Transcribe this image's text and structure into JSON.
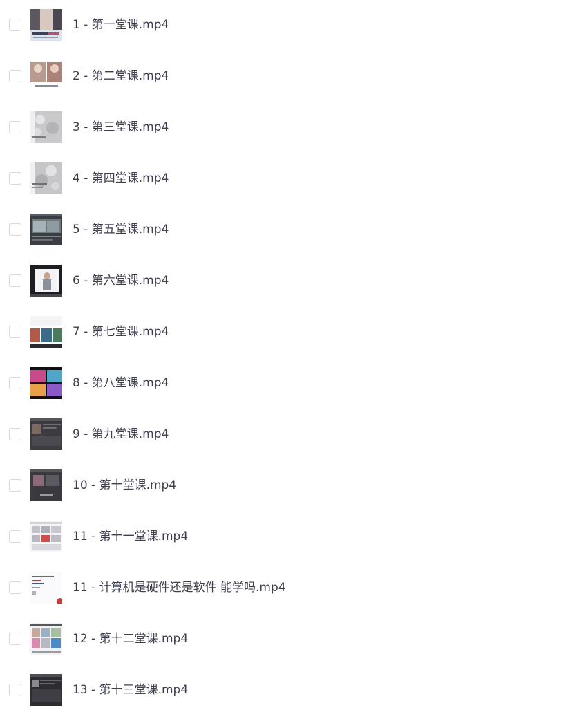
{
  "files": [
    {
      "name": "1 - 第一堂课.mp4",
      "thumb": "thumb-portrait-collage"
    },
    {
      "name": "2 - 第二堂课.mp4",
      "thumb": "thumb-portrait-pair"
    },
    {
      "name": "3 - 第三堂课.mp4",
      "thumb": "thumb-texture-gray"
    },
    {
      "name": "4 - 第四堂课.mp4",
      "thumb": "thumb-texture-gray"
    },
    {
      "name": "5 - 第五堂课.mp4",
      "thumb": "thumb-editor-dark"
    },
    {
      "name": "6 - 第六堂课.mp4",
      "thumb": "thumb-figure-dark"
    },
    {
      "name": "7 - 第七堂课.mp4",
      "thumb": "thumb-photos-white"
    },
    {
      "name": "8 - 第八堂课.mp4",
      "thumb": "thumb-colorful-grid"
    },
    {
      "name": "9 - 第九堂课.mp4",
      "thumb": "thumb-editor-dark"
    },
    {
      "name": "10 - 第十堂课.mp4",
      "thumb": "thumb-editor-dark"
    },
    {
      "name": "11 - 第十一堂课.mp4",
      "thumb": "thumb-grid-light"
    },
    {
      "name": "11 - 计算机是硬件还是软件 能学吗.mp4",
      "thumb": "thumb-document-white"
    },
    {
      "name": "12 - 第十二堂课.mp4",
      "thumb": "thumb-grid-light"
    },
    {
      "name": "13 - 第十三堂课.mp4",
      "thumb": "thumb-editor-dark"
    }
  ]
}
